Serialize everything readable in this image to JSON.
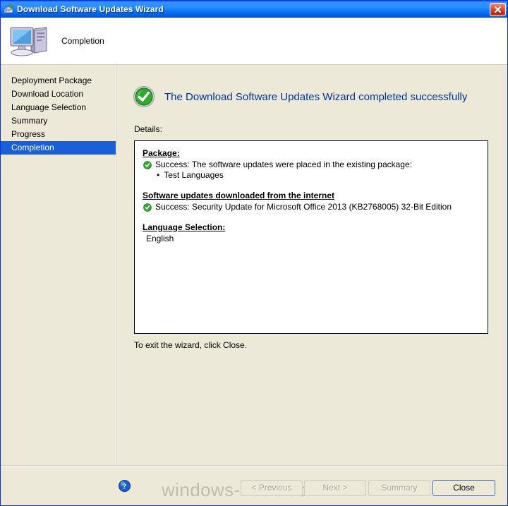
{
  "window": {
    "title": "Download Software Updates Wizard",
    "title_icon": "wizard-package-icon",
    "close_icon": "close-icon"
  },
  "header": {
    "title": "Completion",
    "icon": "computer-icon"
  },
  "sidebar": {
    "items": [
      {
        "label": "Deployment Package",
        "active": false
      },
      {
        "label": "Download Location",
        "active": false
      },
      {
        "label": "Language Selection",
        "active": false
      },
      {
        "label": "Summary",
        "active": false
      },
      {
        "label": "Progress",
        "active": false
      },
      {
        "label": "Completion",
        "active": true
      }
    ]
  },
  "main": {
    "success_icon": "green-check-circle-icon",
    "success_message": "The Download Software Updates Wizard completed successfully",
    "details_label": "Details:",
    "details": {
      "package_heading": "Package:",
      "package_status_icon": "green-check-icon",
      "package_status": "Success: The software updates were placed in the existing package:",
      "package_item": "Test Languages",
      "downloads_heading": "Software updates downloaded from the internet",
      "downloads_status_icon": "green-check-icon",
      "downloads_status": "Success: Security Update for Microsoft Office 2013 (KB2768005) 32-Bit Edition",
      "language_heading": "Language Selection:",
      "language_value": "English"
    },
    "exit_note": "To exit the wizard, click Close."
  },
  "footer": {
    "help_icon": "help-question-icon",
    "watermark": "windows-noob.com",
    "buttons": {
      "previous": "< Previous",
      "next": "Next >",
      "summary": "Summary",
      "close": "Close"
    }
  },
  "colors": {
    "titlebar_blue": "#0058e6",
    "selection_blue": "#1b5fd6",
    "heading_blue": "#003399",
    "success_green": "#2aa22a",
    "window_beige": "#ece9d8",
    "close_red": "#c6301b"
  }
}
